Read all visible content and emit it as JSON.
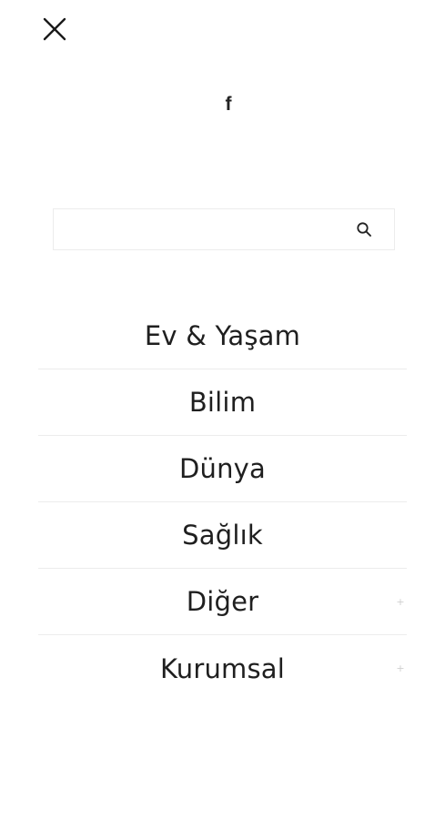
{
  "header": {
    "close_icon": "close-icon"
  },
  "social": {
    "facebook_label": "f",
    "facebook_icon": "facebook-icon"
  },
  "search": {
    "value": "",
    "placeholder": "",
    "icon": "search-icon"
  },
  "menu": {
    "items": [
      {
        "label": "Ev & Yaşam",
        "has_submenu": false
      },
      {
        "label": "Bilim",
        "has_submenu": false
      },
      {
        "label": "Dünya",
        "has_submenu": false
      },
      {
        "label": "Sağlık",
        "has_submenu": false
      },
      {
        "label": "Diğer",
        "has_submenu": true,
        "toggle": "+"
      },
      {
        "label": "Kurumsal",
        "has_submenu": true,
        "toggle": "+"
      }
    ]
  },
  "colors": {
    "text": "#1f1f1f",
    "divider": "#ececec",
    "background": "#ffffff",
    "toggle": "#d0d0d0"
  }
}
